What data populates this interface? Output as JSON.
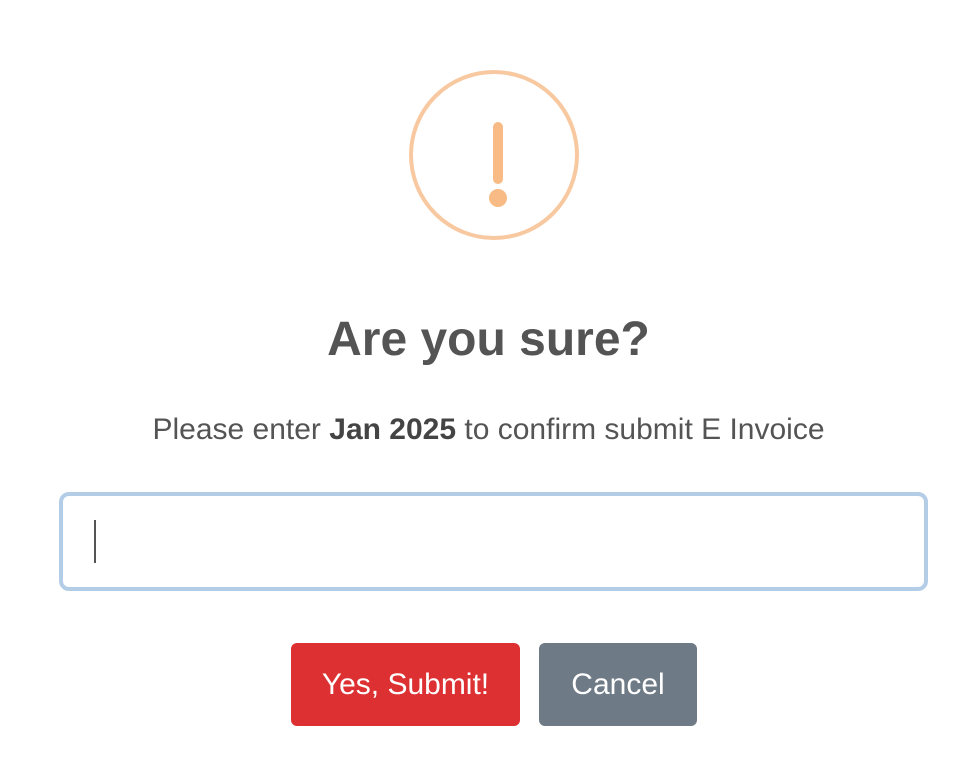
{
  "dialog": {
    "title": "Are you sure?",
    "message": {
      "prefix": "Please enter ",
      "highlight": "Jan 2025",
      "suffix": " to confirm submit E Invoice"
    },
    "input": {
      "value": "",
      "placeholder": ""
    },
    "buttons": {
      "confirm": "Yes, Submit!",
      "cancel": "Cancel"
    }
  },
  "icons": {
    "warning": "warning-icon"
  },
  "colors": {
    "warning": "#f8bb86",
    "confirm_button": "#dd3033",
    "cancel_button": "#6e7a85",
    "input_focus_border": "#b4cde6",
    "text": "#545454"
  }
}
